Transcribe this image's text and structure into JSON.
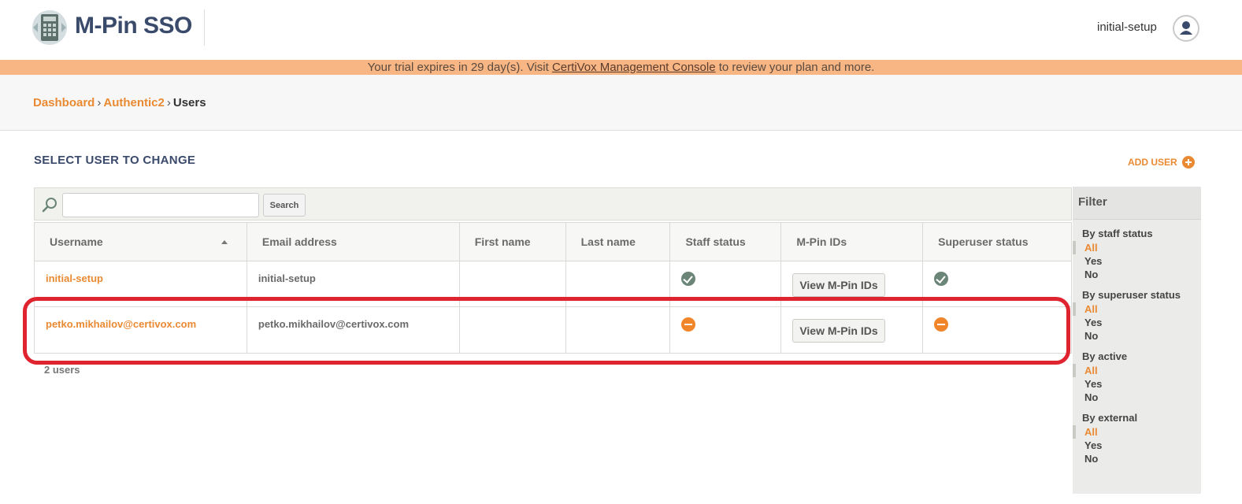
{
  "header": {
    "brand": "M-Pin SSO",
    "username": "initial-setup"
  },
  "banner": {
    "before": "Your trial expires in 29 day(s). Visit ",
    "link": "CertiVox Management Console",
    "after": " to review your plan and more."
  },
  "breadcrumb": {
    "items": [
      "Dashboard",
      "Authentic2"
    ],
    "current": "Users",
    "separator": "›"
  },
  "page": {
    "title": "SELECT USER TO CHANGE",
    "add_user": "ADD USER"
  },
  "search": {
    "value": "",
    "button": "Search"
  },
  "table": {
    "columns": [
      "Username",
      "Email address",
      "First name",
      "Last name",
      "Staff status",
      "M-Pin IDs",
      "Superuser status"
    ],
    "rows": [
      {
        "username": "initial-setup",
        "email": "initial-setup",
        "first_name": "",
        "last_name": "",
        "staff_status": "yes",
        "mpin_button": "View M-Pin IDs",
        "superuser_status": "yes"
      },
      {
        "username": "petko.mikhailov@certivox.com",
        "email": "petko.mikhailov@certivox.com",
        "first_name": "",
        "last_name": "",
        "staff_status": "no",
        "mpin_button": "View M-Pin IDs",
        "superuser_status": "no"
      }
    ],
    "count": "2 users"
  },
  "filter": {
    "title": "Filter",
    "groups": [
      {
        "heading": "By staff status",
        "options": [
          "All",
          "Yes",
          "No"
        ]
      },
      {
        "heading": "By superuser status",
        "options": [
          "All",
          "Yes",
          "No"
        ]
      },
      {
        "heading": "By active",
        "options": [
          "All",
          "Yes",
          "No"
        ]
      },
      {
        "heading": "By external",
        "options": [
          "All",
          "Yes",
          "No"
        ]
      }
    ],
    "selected": "All"
  },
  "colors": {
    "accent": "#e98a33",
    "banner": "#f8b685",
    "brand": "#3a4a6b",
    "highlight": "#e0242f",
    "status_yes": "#6b8578",
    "status_no": "#f0852a"
  }
}
